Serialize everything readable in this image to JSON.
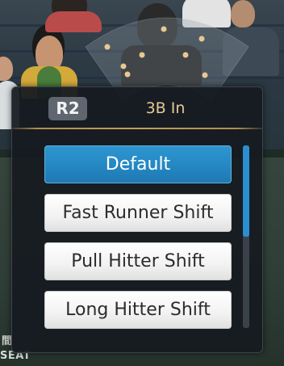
{
  "header": {
    "button_label": "R2",
    "title": "3B In"
  },
  "menu": {
    "options": [
      {
        "label": "Default",
        "selected": true
      },
      {
        "label": "Fast Runner Shift",
        "selected": false
      },
      {
        "label": "Pull Hitter Shift",
        "selected": false
      },
      {
        "label": "Long Hitter Shift",
        "selected": false
      }
    ],
    "scroll_fraction_visible": 0.5
  },
  "background": {
    "seat_sign": "SEAT",
    "seat_kanji": "間"
  },
  "colors": {
    "accent_blue": "#2589c4",
    "title_gold": "#e8c892",
    "divider_gold": "#c59d5a",
    "panel": "#161b21"
  }
}
